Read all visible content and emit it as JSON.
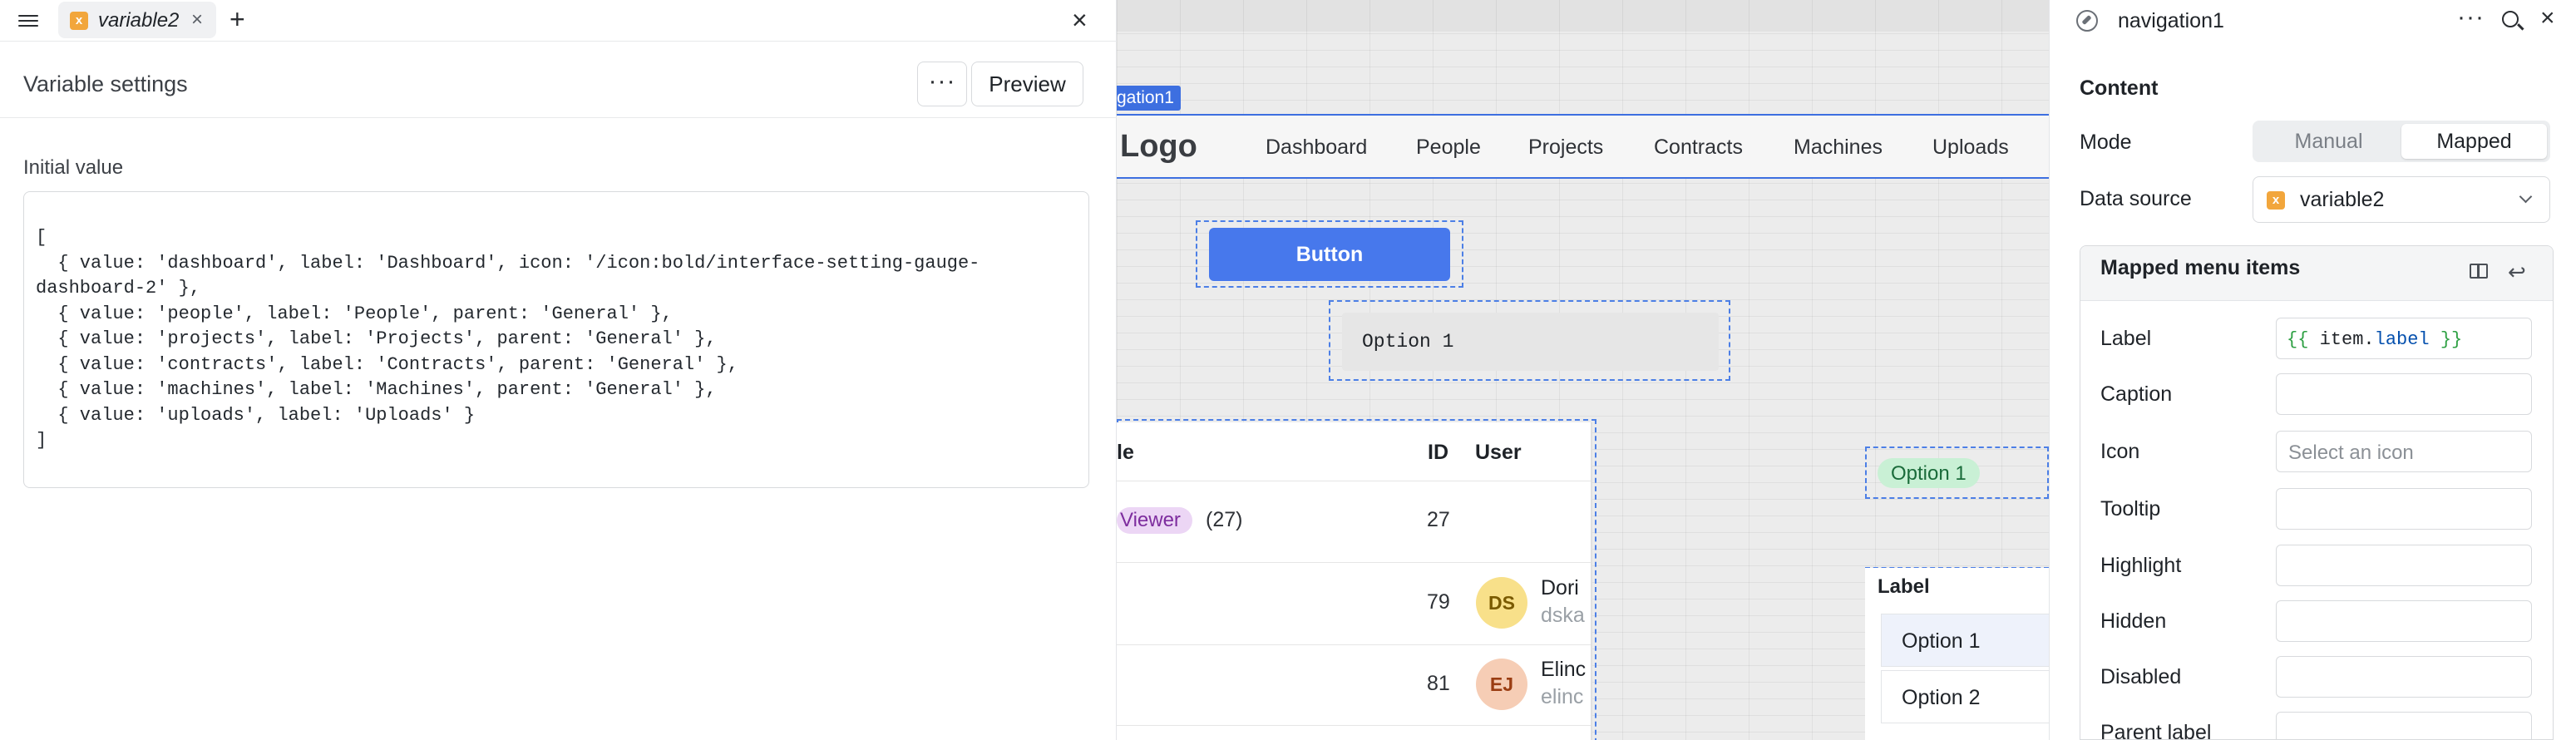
{
  "left_panel": {
    "tab": {
      "label": "variable2",
      "icon": "variable-icon"
    },
    "settings_title": "Variable settings",
    "more_label": "···",
    "preview_label": "Preview",
    "initial_value_label": "Initial value",
    "code": "[\n  { value: 'dashboard', label: 'Dashboard', icon: '/icon:bold/interface-setting-gauge-dashboard-2' },\n  { value: 'people', label: 'People', parent: 'General' },\n  { value: 'projects', label: 'Projects', parent: 'General' },\n  { value: 'contracts', label: 'Contracts', parent: 'General' },\n  { value: 'machines', label: 'Machines', parent: 'General' },\n  { value: 'uploads', label: 'Uploads' }\n]"
  },
  "canvas": {
    "nav_tag": "gation1",
    "logo": "Logo",
    "nav_links": [
      "Dashboard",
      "People",
      "Projects",
      "Contracts",
      "Machines",
      "Uploads"
    ],
    "button_label": "Button",
    "option_input": "Option 1",
    "table": {
      "headers": [
        "le",
        "ID",
        "User"
      ],
      "rows": [
        {
          "role": "Viewer",
          "role_count": "(27)",
          "id": "27",
          "initials": "",
          "name": "",
          "email": ""
        },
        {
          "role": "",
          "role_count": "",
          "id": "79",
          "initials": "DS",
          "name": "Dori",
          "email": "dska"
        },
        {
          "role": "",
          "role_count": "",
          "id": "81",
          "initials": "EJ",
          "name": "Elinc",
          "email": "elinc"
        }
      ]
    },
    "green_pill": "Option 1",
    "list_label": "Label",
    "list_items": [
      "Option 1",
      "Option 2"
    ]
  },
  "right_panel": {
    "title": "navigation1",
    "content_label": "Content",
    "mode_label": "Mode",
    "mode_options": [
      "Manual",
      "Mapped"
    ],
    "mode_selected": "Mapped",
    "data_source_label": "Data source",
    "data_source_value": "variable2",
    "mapped_title": "Mapped menu items",
    "fields": [
      {
        "label": "Label",
        "value": "{{ item.label }}"
      },
      {
        "label": "Caption",
        "value": ""
      },
      {
        "label": "Icon",
        "value": "",
        "placeholder": "Select an icon"
      },
      {
        "label": "Tooltip",
        "value": ""
      },
      {
        "label": "Highlight",
        "value": ""
      },
      {
        "label": "Hidden",
        "value": ""
      },
      {
        "label": "Disabled",
        "value": ""
      },
      {
        "label": "Parent label",
        "value": ""
      }
    ]
  },
  "colors": {
    "accent": "#4778ec",
    "selection": "#4c7fe6",
    "variable_icon": "#f2a63c",
    "viewer_pill": "#ecd6f5",
    "green_pill": "#c9f0d5"
  }
}
